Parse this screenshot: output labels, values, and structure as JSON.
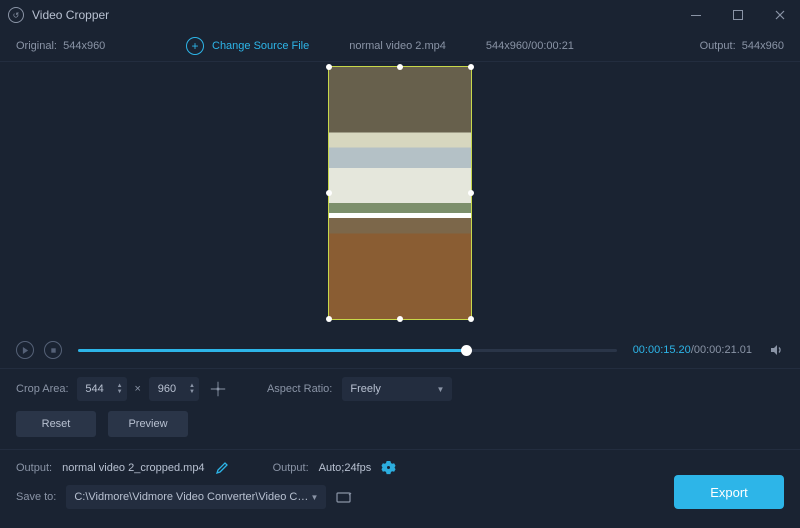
{
  "titlebar": {
    "title": "Video Cropper"
  },
  "infobar": {
    "original_label": "Original:",
    "original_dim": "544x960",
    "change_source": "Change Source File",
    "filename": "normal video 2.mp4",
    "src_meta": "544x960/00:00:21",
    "output_label": "Output:",
    "output_dim": "544x960"
  },
  "player": {
    "current": "00:00:15.20",
    "total": "00:00:21.01",
    "progress_pct": 72
  },
  "controls": {
    "crop_area_label": "Crop Area:",
    "width": "544",
    "height": "960",
    "aspect_label": "Aspect Ratio:",
    "aspect_value": "Freely",
    "reset": "Reset",
    "preview": "Preview"
  },
  "bottom": {
    "output_label": "Output:",
    "output_file": "normal video 2_cropped.mp4",
    "format_label": "Output:",
    "format_value": "Auto;24fps",
    "save_label": "Save to:",
    "save_path": "C:\\Vidmore\\Vidmore Video Converter\\Video Crop",
    "export": "Export"
  }
}
